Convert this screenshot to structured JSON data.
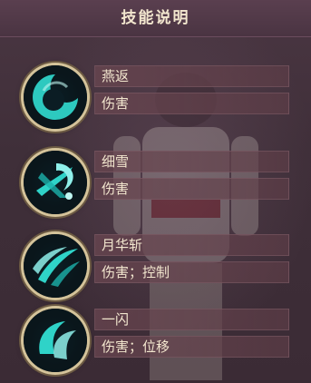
{
  "header": {
    "title": "技能说明"
  },
  "skills": [
    {
      "name": "燕返",
      "tags": "伤害",
      "icon": "crescent-swirl-icon"
    },
    {
      "name": "细雪",
      "tags": "伤害",
      "icon": "slash-burst-icon"
    },
    {
      "name": "月华斩",
      "tags": "伤害；控制",
      "icon": "moon-slash-icon"
    },
    {
      "name": "一闪",
      "tags": "伤害；位移",
      "icon": "dash-wave-icon"
    }
  ],
  "colors": {
    "text": "#f3e7cf",
    "accent": "#2fd3c8",
    "frame": "#d4c39a"
  }
}
